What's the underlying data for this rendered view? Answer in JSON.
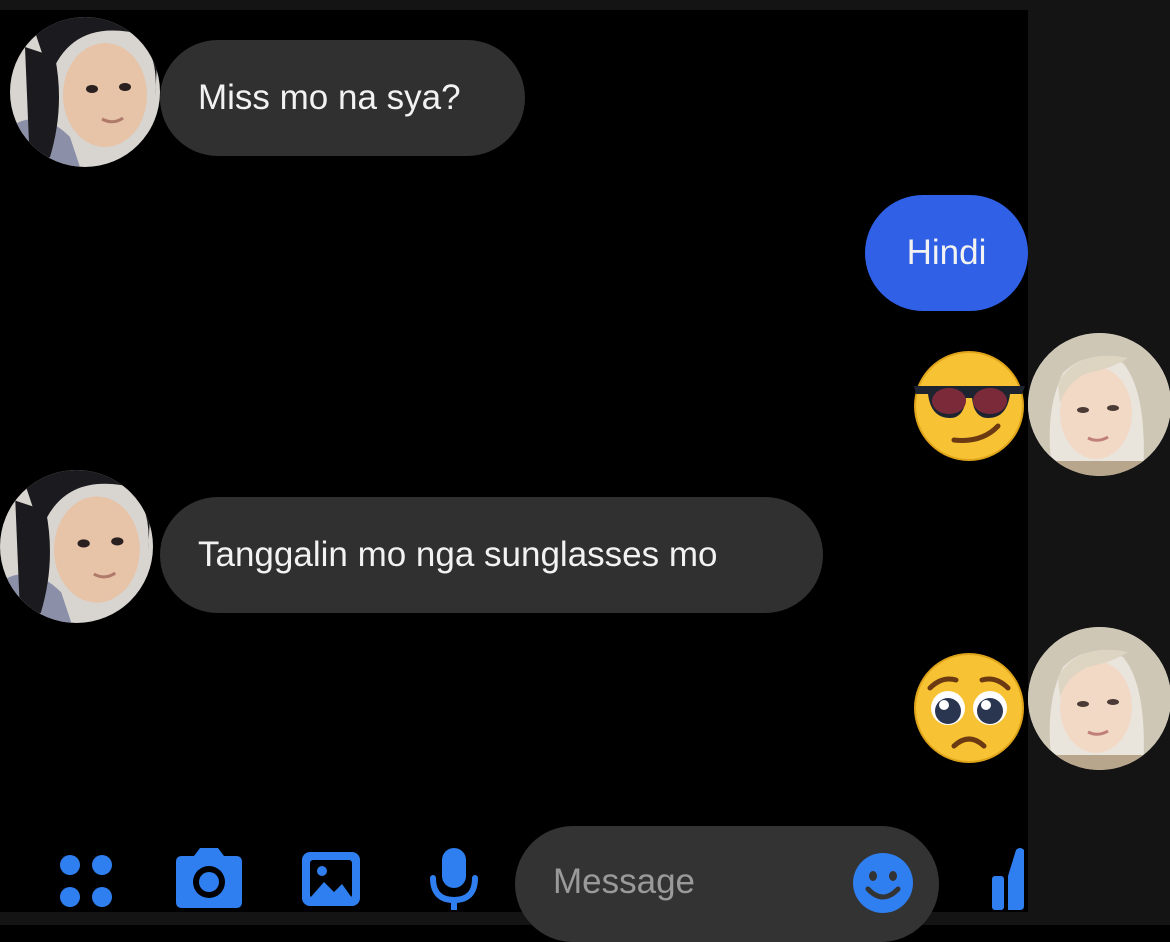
{
  "conversation": {
    "messages": [
      {
        "direction": "incoming",
        "kind": "text",
        "text": "Miss mo na sya?"
      },
      {
        "direction": "outgoing",
        "kind": "text",
        "text": "Hindi"
      },
      {
        "direction": "outgoing",
        "kind": "emoji",
        "emoji": "smiling-face-with-sunglasses"
      },
      {
        "direction": "incoming",
        "kind": "text",
        "text": "Tanggalin mo nga sunglasses mo"
      },
      {
        "direction": "outgoing",
        "kind": "emoji",
        "emoji": "pleading-face"
      }
    ]
  },
  "composer": {
    "placeholder": "Message",
    "icons": [
      "more-apps-icon",
      "camera-icon",
      "gallery-icon",
      "microphone-icon",
      "emoji-icon",
      "thumbs-up-icon"
    ]
  },
  "colors": {
    "background": "#000000",
    "incoming_bubble": "#303030",
    "outgoing_bubble": "#2f60e6",
    "accent_icon": "#2f7ff0"
  }
}
